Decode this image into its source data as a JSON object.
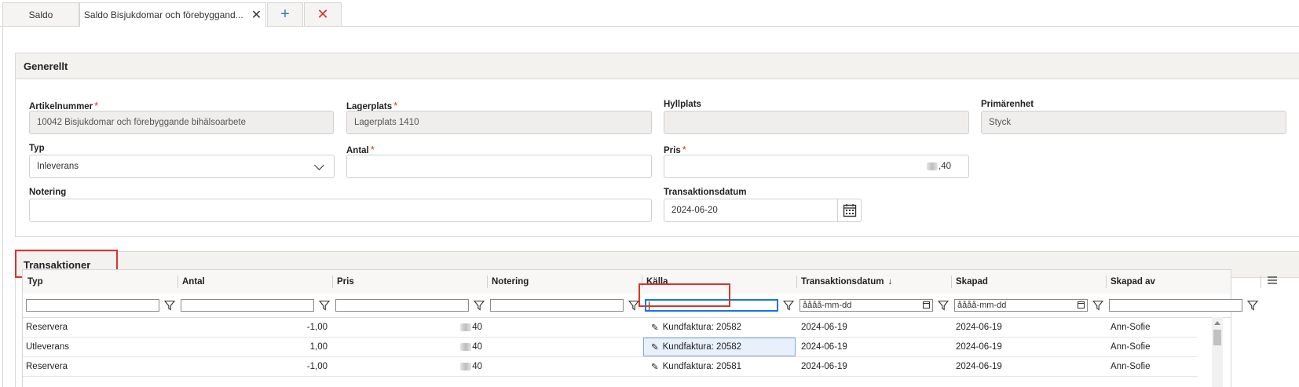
{
  "tabs": [
    {
      "label": "Saldo"
    },
    {
      "label": "Saldo Bisjukdomar och förebyggand..."
    }
  ],
  "general": {
    "title": "Generellt",
    "artikelnummer_label": "Artikelnummer",
    "artikelnummer_value": "10042 Bisjukdomar och förebyggande bihälsoarbete",
    "lagerplats_label": "Lagerplats",
    "lagerplats_value": "Lagerplats 1410",
    "hyllplats_label": "Hyllplats",
    "hyllplats_value": "",
    "primarenhet_label": "Primärenhet",
    "primarenhet_value": "Styck",
    "typ_label": "Typ",
    "typ_value": "Inleverans",
    "antal_label": "Antal",
    "antal_value": "",
    "pris_label": "Pris",
    "pris_value": ",40",
    "notering_label": "Notering",
    "notering_value": "",
    "transaktionsdatum_label": "Transaktionsdatum",
    "transaktionsdatum_value": "2024-06-20",
    "required_mark": "*"
  },
  "transactions": {
    "title": "Transaktioner",
    "columns": [
      "Typ",
      "Antal",
      "Pris",
      "Notering",
      "Källa",
      "Transaktionsdatum",
      "Skapad",
      "Skapad av"
    ],
    "sort_indicator": "↓",
    "date_placeholder": "åååå-mm-dd",
    "rows": [
      {
        "typ": "Reservera",
        "antal": "-1,00",
        "pris": "40",
        "notering": "",
        "kalla": "Kundfaktura: 20582",
        "transdatum": "2024-06-19",
        "skapad": "2024-06-19",
        "skapad_av": "Ann-Sofie"
      },
      {
        "typ": "Utleverans",
        "antal": "1,00",
        "pris": "40",
        "notering": "",
        "kalla": "Kundfaktura: 20582",
        "transdatum": "2024-06-19",
        "skapad": "2024-06-19",
        "skapad_av": "Ann-Sofie"
      },
      {
        "typ": "Reservera",
        "antal": "-1,00",
        "pris": "40",
        "notering": "",
        "kalla": "Kundfaktura: 20581",
        "transdatum": "2024-06-19",
        "skapad": "2024-06-19",
        "skapad_av": "Ann-Sofie"
      }
    ]
  },
  "colors": {
    "accent": "#2b7cd3",
    "danger": "#d9342b",
    "header_bg": "#f4f2ef"
  }
}
